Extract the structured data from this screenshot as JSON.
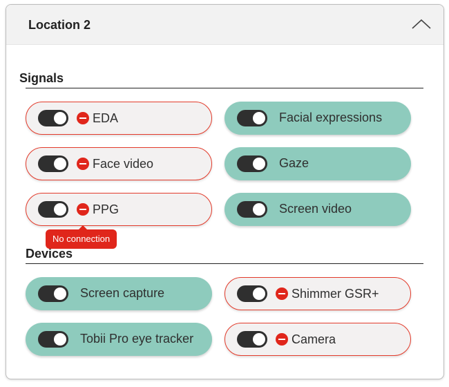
{
  "panel": {
    "title": "Location 2"
  },
  "signals": {
    "title": "Signals",
    "items": [
      {
        "label": "EDA",
        "status": "error",
        "enabled": true
      },
      {
        "label": "Facial expressions",
        "status": "ok",
        "enabled": true
      },
      {
        "label": "Face video",
        "status": "error",
        "enabled": true
      },
      {
        "label": "Gaze",
        "status": "ok",
        "enabled": true
      },
      {
        "label": "PPG",
        "status": "error",
        "enabled": true
      },
      {
        "label": "Screen video",
        "status": "ok",
        "enabled": true
      }
    ]
  },
  "tooltip": {
    "text": "No connection"
  },
  "devices": {
    "title": "Devices",
    "items": [
      {
        "label": "Screen capture",
        "status": "ok",
        "enabled": true
      },
      {
        "label": "Shimmer GSR+",
        "status": "error",
        "enabled": true
      },
      {
        "label": "Tobii Pro eye tracker",
        "status": "ok",
        "enabled": true
      },
      {
        "label": "Camera",
        "status": "error",
        "enabled": true
      }
    ]
  },
  "colors": {
    "ok": "#8ecbbd",
    "error": "#e0261b",
    "toggle": "#2f2f2f"
  },
  "icons": {
    "collapse": "chevron-up-icon",
    "error": "minus-circle-icon"
  }
}
